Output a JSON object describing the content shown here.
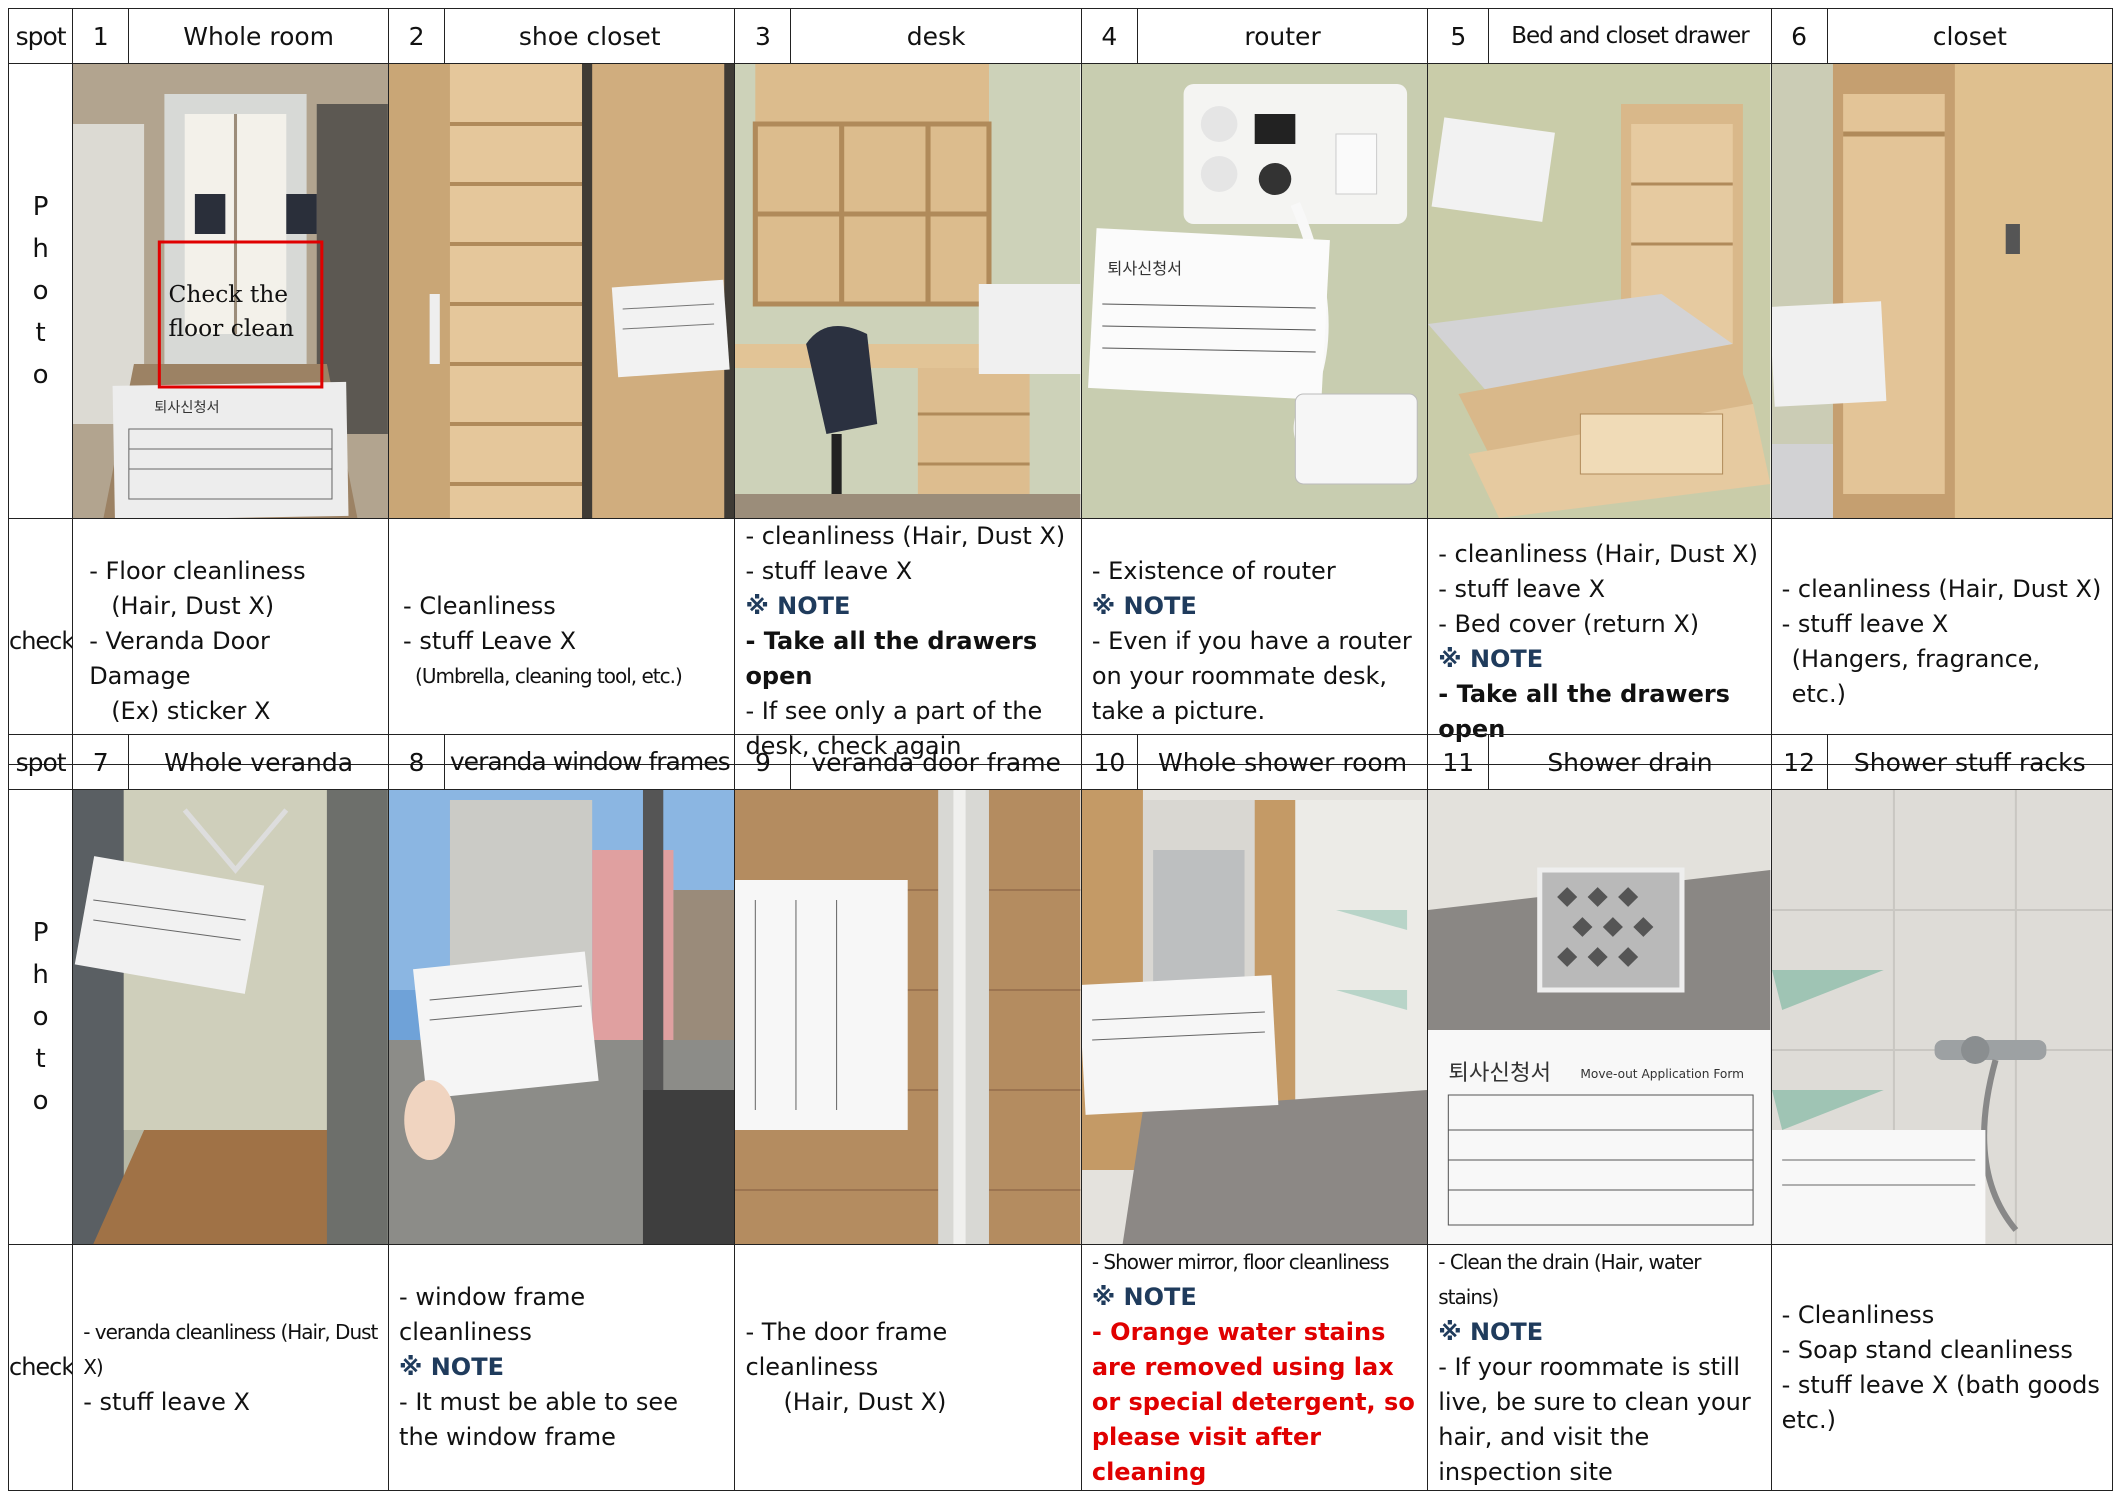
{
  "labels": {
    "spot": "spot",
    "photo": [
      "P",
      "h",
      "o",
      "t",
      "o"
    ],
    "check": "check"
  },
  "overlay": {
    "line1": "Check the",
    "line2": "floor clean"
  },
  "table1": {
    "spots": [
      {
        "num": "1",
        "name": "Whole room"
      },
      {
        "num": "2",
        "name": "shoe closet"
      },
      {
        "num": "3",
        "name": "desk"
      },
      {
        "num": "4",
        "name": "router"
      },
      {
        "num": "5",
        "name": "Bed and closet drawer"
      },
      {
        "num": "6",
        "name": "closet"
      }
    ],
    "checks": [
      [
        "- Floor cleanliness",
        "(Hair, Dust X)",
        "- Veranda Door Damage",
        "(Ex) sticker X"
      ],
      [
        "- Cleanliness",
        "- stuff Leave X",
        "(Umbrella, cleaning tool, etc.)"
      ],
      [
        "- cleanliness (Hair, Dust X)",
        "- stuff leave X",
        "※ NOTE",
        "- Take all the drawers open",
        "- If see only a part of the desk, check again"
      ],
      [
        "- Existence of router",
        "※ NOTE",
        "- Even if you have a router on your roommate desk, take a picture."
      ],
      [
        "- cleanliness (Hair, Dust X)",
        "- stuff leave X",
        "- Bed cover (return X)",
        "※ NOTE",
        "- Take all the drawers open"
      ],
      [
        "- cleanliness (Hair, Dust X)",
        "- stuff leave X",
        "(Hangers, fragrance, etc.)"
      ]
    ]
  },
  "table2": {
    "spots": [
      {
        "num": "7",
        "name": "Whole veranda"
      },
      {
        "num": "8",
        "name": "veranda window frames"
      },
      {
        "num": "9",
        "name": "veranda door frame"
      },
      {
        "num": "10",
        "name": "Whole shower room"
      },
      {
        "num": "11",
        "name": "Shower drain"
      },
      {
        "num": "12",
        "name": "Shower stuff racks"
      }
    ],
    "checks": [
      [
        "- veranda cleanliness (Hair, Dust X)",
        "- stuff leave X"
      ],
      [
        "- window frame cleanliness",
        "※ NOTE",
        "- It must be able to see the window frame"
      ],
      [
        "- The door frame cleanliness",
        "(Hair, Dust X)"
      ],
      [
        "- Shower mirror, floor cleanliness",
        "※ NOTE",
        "- Orange water stains are removed using lax or special detergent, so please visit after cleaning"
      ],
      [
        "- Clean the drain (Hair, water stains)",
        "※ NOTE",
        "- If your roommate is still live, be sure to clean your hair, and visit the inspection site"
      ],
      [
        "- Cleanliness",
        "- Soap stand cleanliness",
        "- stuff leave X (bath goods etc.)"
      ]
    ]
  },
  "form_text": {
    "title": "퇴사신청서",
    "sub": "Move-out Application Form"
  },
  "colors": {
    "wood": "#d9b88a",
    "wall": "#cfd3b8",
    "note": "#1f3b5c",
    "red": "#e00000",
    "tile": "#d6d2cc"
  }
}
